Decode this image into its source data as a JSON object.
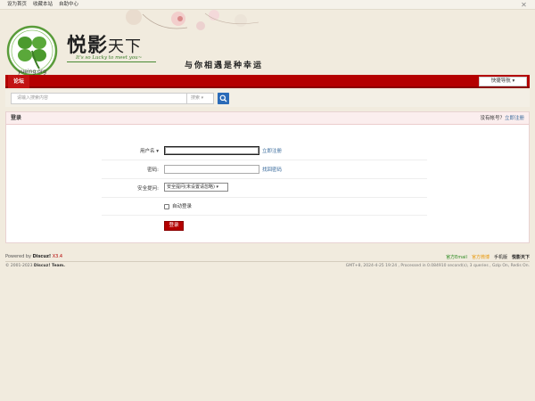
{
  "topbar": {
    "links": [
      "设为首页",
      "收藏本站",
      "自助中心"
    ],
    "close_symbol": "✕"
  },
  "header": {
    "logo_text": "yueing.org",
    "title_main": "悦影",
    "title_sub": "天下",
    "slogan": "It's so Lucky to meet you~",
    "tagline": "与你相遇是种幸运"
  },
  "nav": {
    "forum_label": "论坛",
    "quick_nav_label": "快捷导航 ▾"
  },
  "search": {
    "placeholder": "请输入搜索内容",
    "type_label": "搜索 ▾"
  },
  "login": {
    "title": "登录",
    "no_account_text": "没有帐号？",
    "register_now_link": "立即注册",
    "username_label": "用户名 ▾",
    "username_value": "",
    "register_link": "立即注册",
    "password_label": "密码:",
    "password_value": "",
    "forgot_link": "找回密码",
    "question_label": "安全提问:",
    "question_selected": "安全提问(未设置请忽略) ▾",
    "auto_login_label": "自动登录",
    "submit_label": "登录"
  },
  "footer": {
    "powered_prefix": "Powered by",
    "powered_name": "Discuz!",
    "powered_version": "X3.4",
    "copyright": "© 2001-2023",
    "copyright_team": "Discuz! Team.",
    "links": [
      {
        "label": "官方Email",
        "color": "green"
      },
      {
        "label": "官方微博",
        "color": "orange"
      },
      {
        "label": "手机版",
        "color": "dark"
      },
      {
        "label": "悦影天下",
        "color": "bold"
      }
    ],
    "gmt_text": "GMT+8, 2024-4-25 19:24 , Processed in 0.084910 second(s), 3 queries , Gzip On, Redis On."
  },
  "colors": {
    "brand_red": "#b40000",
    "link_blue": "#336699",
    "search_button": "#2b6bb8",
    "page_bg": "#f1ebde"
  }
}
